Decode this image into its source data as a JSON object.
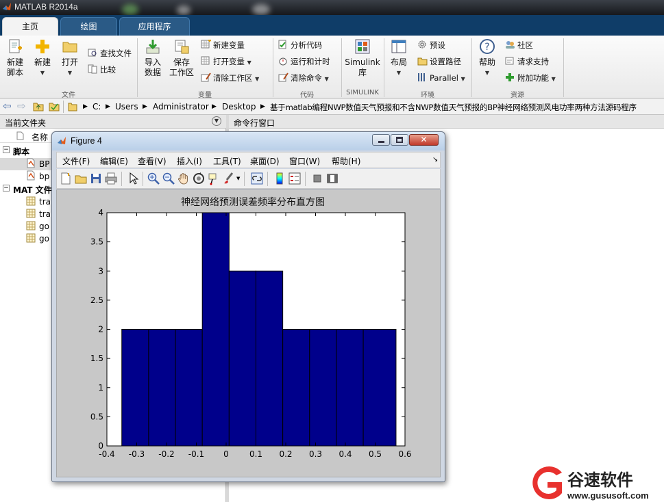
{
  "window": {
    "title": "MATLAB R2014a"
  },
  "tabs": [
    {
      "label": "主页"
    },
    {
      "label": "绘图"
    },
    {
      "label": "应用程序"
    }
  ],
  "ribbon": {
    "file": {
      "new_script": [
        "新建",
        "脚本"
      ],
      "new": "新建",
      "open": "打开",
      "find_files": "查找文件",
      "compare": "比较",
      "group": "文件"
    },
    "variable": {
      "import": [
        "导入",
        "数据"
      ],
      "save_ws": [
        "保存",
        "工作区"
      ],
      "new_var": "新建变量",
      "open_var": "打开变量",
      "clear_ws": "清除工作区",
      "group": "变量"
    },
    "code": {
      "analyze": "分析代码",
      "run_time": "运行和计时",
      "clear_cmd": "清除命令",
      "group": "代码"
    },
    "simulink": {
      "label": [
        "Simulink",
        "库"
      ],
      "group": "SIMULINK"
    },
    "env": {
      "layout": "布局",
      "prefs": "预设",
      "set_path": "设置路径",
      "parallel": "Parallel",
      "group": "环境"
    },
    "resources": {
      "help": "帮助",
      "community": "社区",
      "support": "请求支持",
      "addons": "附加功能",
      "group": "资源"
    }
  },
  "address": {
    "crumbs": [
      "C:",
      "Users",
      "Administrator",
      "Desktop",
      "基于matlab编程NWP数值天气预报和不含NWP数值天气预报的BP神经网络预测风电功率两种方法源码程序"
    ]
  },
  "left_panel": {
    "title": "当前文件夹",
    "col_name": "名称",
    "sections": [
      {
        "label": "脚本",
        "items": [
          "BP",
          "bp"
        ]
      },
      {
        "label": "MAT 文件",
        "items": [
          "tra",
          "tra",
          "go",
          "go"
        ]
      }
    ]
  },
  "command_window": {
    "title": "命令行窗口"
  },
  "figure": {
    "title": "Figure 4",
    "menus": [
      "文件(F)",
      "编辑(E)",
      "查看(V)",
      "插入(I)",
      "工具(T)",
      "桌面(D)",
      "窗口(W)",
      "帮助(H)"
    ]
  },
  "watermark": {
    "text": "谷速软件",
    "url": "www.gususoft.com"
  },
  "colors": {
    "bar": "#00008b",
    "ribbon_tab": "#0f3d68",
    "watermark": "#e8312e"
  },
  "chart_data": {
    "type": "bar",
    "title": "神经网络预测误差频率分布直方图",
    "bin_edges": [
      -0.35,
      -0.26,
      -0.17,
      -0.08,
      0.01,
      0.1,
      0.19,
      0.28,
      0.37,
      0.46,
      0.57
    ],
    "values": [
      2,
      2,
      2,
      4,
      3,
      3,
      2,
      2,
      2,
      2
    ],
    "xlim": [
      -0.4,
      0.6
    ],
    "ylim": [
      0,
      4
    ],
    "xticks": [
      "-0.4",
      "-0.3",
      "-0.2",
      "-0.1",
      "0",
      "0.1",
      "0.2",
      "0.3",
      "0.4",
      "0.5",
      "0.6"
    ],
    "yticks": [
      "0",
      "0.5",
      "1",
      "1.5",
      "2",
      "2.5",
      "3",
      "3.5",
      "4"
    ],
    "grid": false
  }
}
